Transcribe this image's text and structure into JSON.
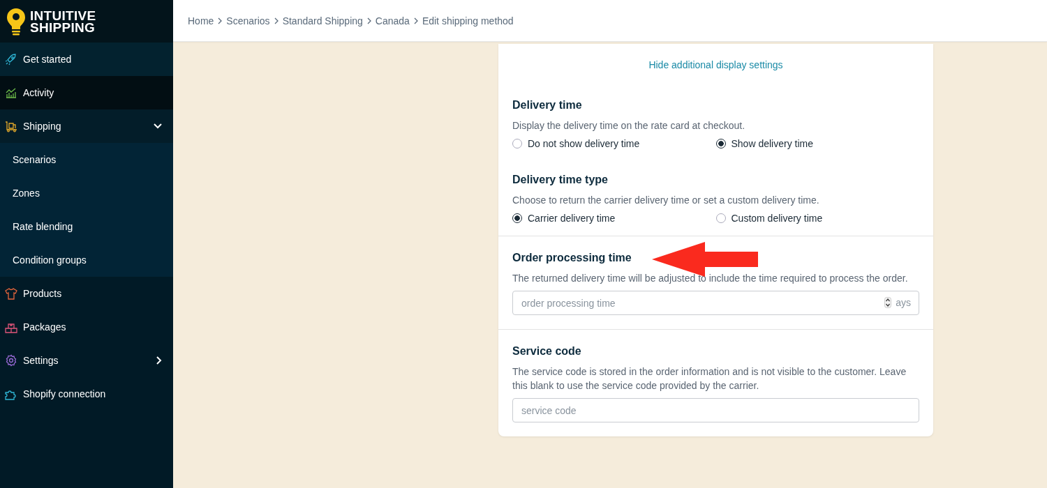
{
  "logo": {
    "line1": "INTUITIVE",
    "line2": "SHIPPING"
  },
  "sidebar": {
    "items": [
      {
        "label": "Get started",
        "selected": false
      },
      {
        "label": "Activity",
        "selected": true
      },
      {
        "label": "Shipping",
        "selected": false,
        "expanded": true,
        "children": [
          {
            "label": "Scenarios"
          },
          {
            "label": "Zones"
          },
          {
            "label": "Rate blending"
          },
          {
            "label": "Condition groups"
          }
        ]
      },
      {
        "label": "Products",
        "selected": false
      },
      {
        "label": "Packages",
        "selected": false
      },
      {
        "label": "Settings",
        "selected": false,
        "expanded": false
      },
      {
        "label": "Shopify connection",
        "selected": false
      }
    ]
  },
  "breadcrumb": [
    "Home",
    "Scenarios",
    "Standard Shipping",
    "Canada",
    "Edit shipping method"
  ],
  "card": {
    "toggle_link": "Hide additional display settings",
    "sections": [
      {
        "title": "Delivery time",
        "description": "Display the delivery time on the rate card at checkout.",
        "radios": [
          {
            "label": "Do not show delivery time",
            "selected": false
          },
          {
            "label": "Show delivery time",
            "selected": true
          }
        ]
      },
      {
        "title": "Delivery time type",
        "description": "Choose to return the carrier delivery time or set a custom delivery time.",
        "radios": [
          {
            "label": "Carrier delivery time",
            "selected": true
          },
          {
            "label": "Custom delivery time",
            "selected": false
          }
        ]
      },
      {
        "title": "Order processing time",
        "description": "The returned delivery time will be adjusted to include the time required to process the order.",
        "field": {
          "placeholder": "order processing time",
          "suffix": "ays"
        }
      },
      {
        "title": "Service code",
        "description": "The service code is stored in the order information and is not visible to the customer. Leave this blank to use the service code provided by the carrier.",
        "field": {
          "placeholder": "service code"
        }
      }
    ]
  }
}
